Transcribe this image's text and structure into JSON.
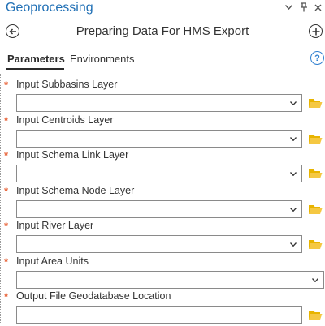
{
  "pane": {
    "title": "Geoprocessing",
    "menu_icon": "chevron-down-icon",
    "pin_icon": "pin-icon",
    "close_icon": "close-icon"
  },
  "tool": {
    "name": "Preparing Data For HMS Export",
    "back_icon": "back-arrow-icon",
    "add_icon": "add-icon"
  },
  "tabs": [
    {
      "label": "Parameters",
      "active": true
    },
    {
      "label": "Environments",
      "active": false
    }
  ],
  "help": {
    "glyph": "?"
  },
  "parameters": [
    {
      "label": "Input Subbasins Layer",
      "required": true,
      "required_mark": "*",
      "value": "",
      "browse": true
    },
    {
      "label": "Input Centroids Layer",
      "required": true,
      "required_mark": "*",
      "value": "",
      "browse": true
    },
    {
      "label": "Input Schema Link Layer",
      "required": true,
      "required_mark": "*",
      "value": "",
      "browse": true
    },
    {
      "label": "Input Schema Node Layer",
      "required": true,
      "required_mark": "*",
      "value": "",
      "browse": true
    },
    {
      "label": "Input River Layer",
      "required": true,
      "required_mark": "*",
      "value": "",
      "browse": true
    },
    {
      "label": "Input Area Units",
      "required": true,
      "required_mark": "*",
      "value": "",
      "browse": false
    },
    {
      "label": "Output File Geodatabase Location",
      "required": true,
      "required_mark": "*",
      "value": "",
      "browse": true
    }
  ],
  "colors": {
    "pane_title": "#1f6fb5",
    "required_marker": "#e8643a",
    "folder": "#e8b400",
    "help": "#2f7fd0"
  }
}
